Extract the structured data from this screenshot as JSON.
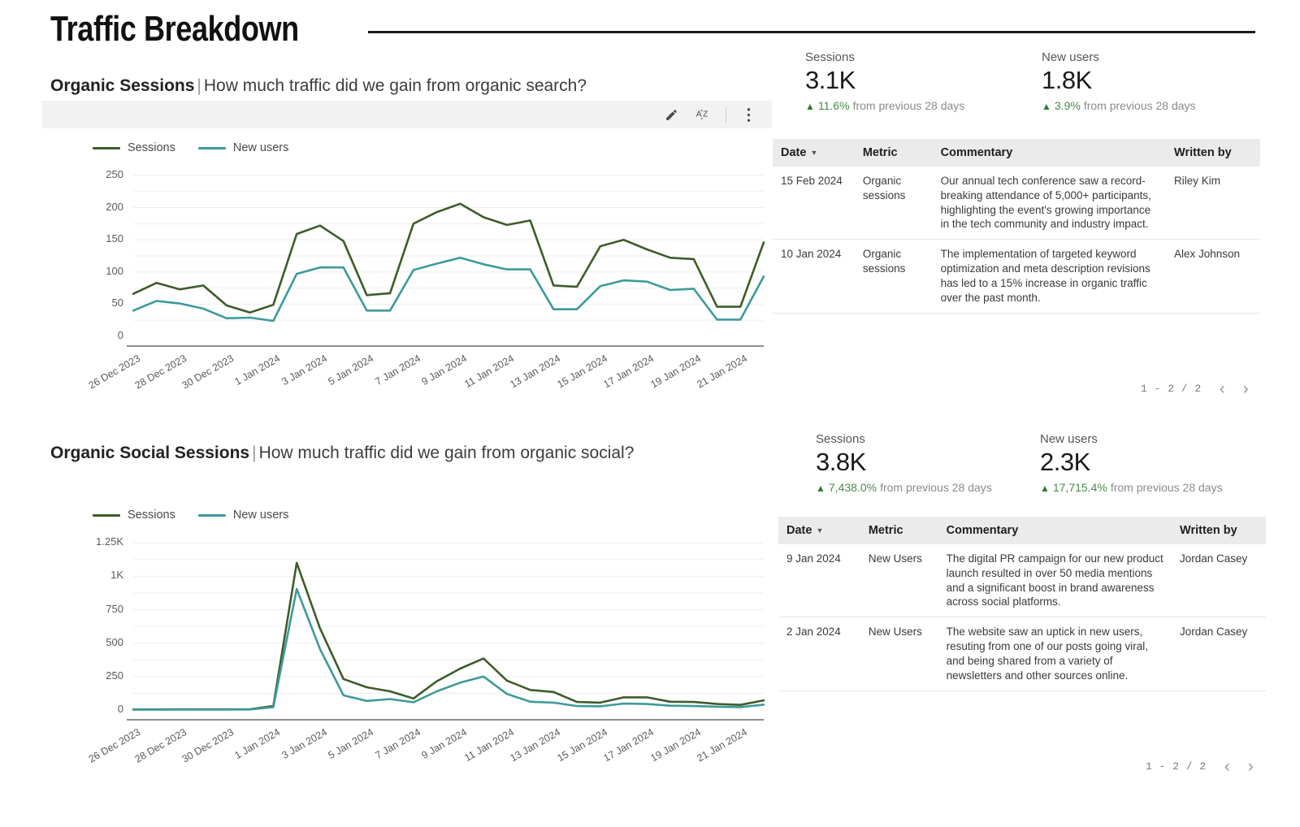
{
  "header": {
    "title": "Traffic Breakdown"
  },
  "sections": [
    {
      "title_bold": "Organic Sessions",
      "separator": "|",
      "question": "How much traffic did we gain from organic search?",
      "toolbar": {
        "edit": "pencil-icon",
        "sort": "sort-az-icon",
        "more": "more-vertical-icon"
      },
      "scorecards": [
        {
          "label": "Sessions",
          "value": "3.1K",
          "delta": "11.6%",
          "delta_suffix": "from previous 28 days",
          "arrow": "▲"
        },
        {
          "label": "New users",
          "value": "1.8K",
          "delta": "3.9%",
          "delta_suffix": "from previous 28 days",
          "arrow": "▲"
        }
      ],
      "table": {
        "columns": [
          "Date",
          "Metric",
          "Commentary",
          "Written by"
        ],
        "sorted_column": "Date",
        "rows": [
          {
            "date": "15 Feb 2024",
            "metric": "Organic sessions",
            "commentary": "Our annual tech conference saw a record-breaking attendance of 5,000+ participants, highlighting the event's growing importance in the tech community and industry impact.",
            "author": "Riley Kim"
          },
          {
            "date": "10 Jan 2024",
            "metric": "Organic sessions",
            "commentary": "The implementation of targeted keyword optimization and meta description revisions has led to a 15% increase in organic traffic over the past month.",
            "author": "Alex Johnson"
          }
        ]
      },
      "pager": {
        "count": "1 - 2 / 2",
        "prev": "‹",
        "next": "›"
      }
    },
    {
      "title_bold": "Organic Social Sessions",
      "separator": "|",
      "question": "How much traffic did we gain from organic social?",
      "scorecards": [
        {
          "label": "Sessions",
          "value": "3.8K",
          "delta": "7,438.0%",
          "delta_suffix": "from previous 28 days",
          "arrow": "▲"
        },
        {
          "label": "New users",
          "value": "2.3K",
          "delta": "17,715.4%",
          "delta_suffix": "from previous 28 days",
          "arrow": "▲"
        }
      ],
      "table": {
        "columns": [
          "Date",
          "Metric",
          "Commentary",
          "Written by"
        ],
        "sorted_column": "Date",
        "rows": [
          {
            "date": "9 Jan 2024",
            "metric": "New Users",
            "commentary": "The digital PR campaign for our new product launch resulted in over 50 media mentions and a significant boost in brand awareness across social platforms.",
            "author": "Jordan Casey"
          },
          {
            "date": "2 Jan 2024",
            "metric": "New Users",
            "commentary": "The website saw an uptick in new users, resuting from one of our posts going viral, and being shared from a variety of newsletters and other sources online.",
            "author": "Jordan Casey"
          }
        ]
      },
      "pager": {
        "count": "1 - 2 / 2",
        "prev": "‹",
        "next": "›"
      }
    }
  ],
  "colors": {
    "sessions": "#3e5c29",
    "new_users": "#3e9a9a",
    "positive": "#4a8a4a",
    "toolbar_bg": "#f2f2f2",
    "table_header_bg": "#ebebeb"
  },
  "chart_data": [
    {
      "type": "line",
      "title": "Organic Sessions",
      "xlabel": "",
      "ylabel": "",
      "grid": true,
      "legend_position": "top-left",
      "ylim": [
        0,
        260
      ],
      "yticks": [
        0,
        50,
        100,
        150,
        200,
        250
      ],
      "ytick_labels": [
        "0",
        "50",
        "100",
        "150",
        "200",
        "250"
      ],
      "x": [
        "26 Dec 2023",
        "27 Dec 2023",
        "28 Dec 2023",
        "29 Dec 2023",
        "30 Dec 2023",
        "31 Dec 2023",
        "1 Jan 2024",
        "2 Jan 2024",
        "3 Jan 2024",
        "4 Jan 2024",
        "5 Jan 2024",
        "6 Jan 2024",
        "7 Jan 2024",
        "8 Jan 2024",
        "9 Jan 2024",
        "10 Jan 2024",
        "11 Jan 2024",
        "12 Jan 2024",
        "13 Jan 2024",
        "14 Jan 2024",
        "15 Jan 2024",
        "16 Jan 2024",
        "17 Jan 2024",
        "18 Jan 2024",
        "19 Jan 2024",
        "20 Jan 2024",
        "21 Jan 2024",
        "22 Jan 2024"
      ],
      "xtick_labels": [
        "26 Dec 2023",
        "28 Dec 2023",
        "30 Dec 2023",
        "1 Jan 2024",
        "3 Jan 2024",
        "5 Jan 2024",
        "7 Jan 2024",
        "9 Jan 2024",
        "11 Jan 2024",
        "13 Jan 2024",
        "15 Jan 2024",
        "17 Jan 2024",
        "19 Jan 2024",
        "21 Jan 2024"
      ],
      "series": [
        {
          "name": "Sessions",
          "values": [
            66,
            83,
            73,
            79,
            48,
            37,
            49,
            159,
            172,
            148,
            64,
            67,
            175,
            193,
            206,
            185,
            173,
            180,
            79,
            77,
            140,
            150,
            135,
            122,
            120,
            46,
            46,
            146
          ]
        },
        {
          "name": "New users",
          "values": [
            40,
            55,
            51,
            43,
            28,
            29,
            24,
            97,
            107,
            107,
            40,
            40,
            103,
            113,
            122,
            112,
            104,
            104,
            42,
            42,
            78,
            87,
            85,
            72,
            74,
            26,
            26,
            93
          ]
        }
      ]
    },
    {
      "type": "line",
      "title": "Organic Social Sessions",
      "xlabel": "",
      "ylabel": "",
      "grid": true,
      "legend_position": "top-left",
      "ylim": [
        0,
        1300
      ],
      "yticks": [
        0,
        250,
        500,
        750,
        1000,
        1250
      ],
      "ytick_labels": [
        "0",
        "250",
        "500",
        "750",
        "1K",
        "1.25K"
      ],
      "x": [
        "26 Dec 2023",
        "27 Dec 2023",
        "28 Dec 2023",
        "29 Dec 2023",
        "30 Dec 2023",
        "31 Dec 2023",
        "1 Jan 2024",
        "2 Jan 2024",
        "3 Jan 2024",
        "4 Jan 2024",
        "5 Jan 2024",
        "6 Jan 2024",
        "7 Jan 2024",
        "8 Jan 2024",
        "9 Jan 2024",
        "10 Jan 2024",
        "11 Jan 2024",
        "12 Jan 2024",
        "13 Jan 2024",
        "14 Jan 2024",
        "15 Jan 2024",
        "16 Jan 2024",
        "17 Jan 2024",
        "18 Jan 2024",
        "19 Jan 2024",
        "20 Jan 2024",
        "21 Jan 2024",
        "22 Jan 2024"
      ],
      "xtick_labels": [
        "26 Dec 2023",
        "28 Dec 2023",
        "30 Dec 2023",
        "1 Jan 2024",
        "3 Jan 2024",
        "5 Jan 2024",
        "7 Jan 2024",
        "9 Jan 2024",
        "11 Jan 2024",
        "13 Jan 2024",
        "15 Jan 2024",
        "17 Jan 2024",
        "19 Jan 2024",
        "21 Jan 2024"
      ],
      "series": [
        {
          "name": "Sessions",
          "values": [
            4,
            4,
            5,
            5,
            5,
            6,
            30,
            1100,
            610,
            232,
            170,
            140,
            86,
            215,
            310,
            385,
            220,
            150,
            135,
            60,
            55,
            95,
            95,
            62,
            60,
            45,
            38,
            72
          ]
        },
        {
          "name": "New users",
          "values": [
            3,
            3,
            3,
            3,
            3,
            4,
            22,
            905,
            455,
            110,
            68,
            82,
            58,
            140,
            205,
            250,
            120,
            62,
            55,
            30,
            28,
            48,
            45,
            32,
            30,
            25,
            22,
            40
          ]
        }
      ]
    }
  ]
}
